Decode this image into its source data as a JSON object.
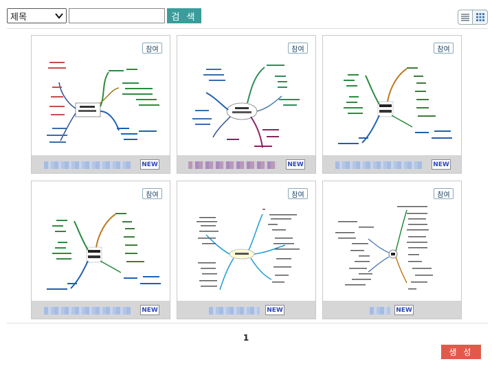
{
  "search": {
    "field_selected": "제목",
    "input_value": "",
    "button_label": "검 색"
  },
  "view_modes": [
    "list-view-icon",
    "grid-view-icon"
  ],
  "cards": [
    {
      "join_label": "참여",
      "badge": "NEW",
      "thumbnail": "mindmap-thumbnail"
    },
    {
      "join_label": "참여",
      "badge": "NEW",
      "thumbnail": "mindmap-thumbnail"
    },
    {
      "join_label": "참여",
      "badge": "NEW",
      "thumbnail": "mindmap-thumbnail"
    },
    {
      "join_label": "참여",
      "badge": "NEW",
      "thumbnail": "mindmap-thumbnail"
    },
    {
      "join_label": "참여",
      "badge": "NEW",
      "thumbnail": "mindmap-thumbnail"
    },
    {
      "join_label": "참여",
      "badge": "NEW",
      "thumbnail": "mindmap-thumbnail"
    }
  ],
  "pagination": {
    "current_page": "1"
  },
  "create_button": "생 성",
  "colors": {
    "search_button": "#3a9d9b",
    "create_button": "#e05a4c",
    "new_badge_text": "#2a47b8",
    "card_footer": "#d6d6d6"
  }
}
